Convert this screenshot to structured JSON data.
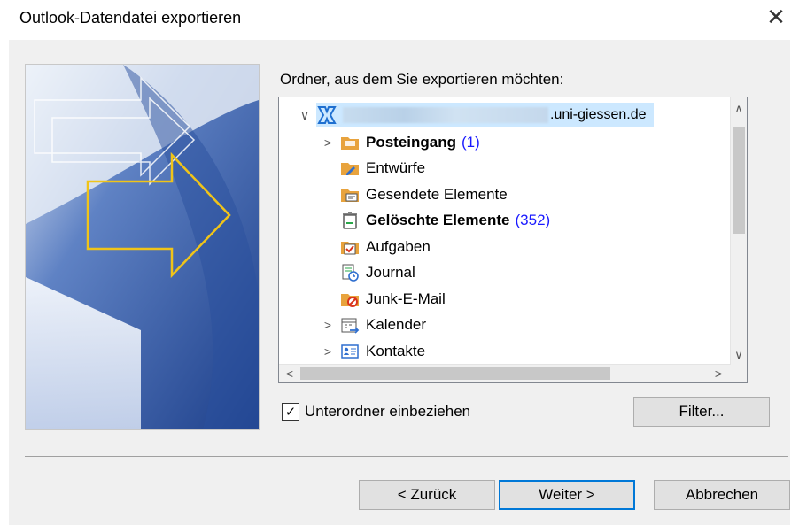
{
  "dialog": {
    "title": "Outlook-Datendatei exportieren",
    "close_glyph": "✕"
  },
  "folder_section": {
    "label": "Ordner, aus dem Sie exportieren möchten:",
    "account": {
      "expander": "∨",
      "domain_suffix": ".uni-giessen.de",
      "icon": "exchange-account-icon"
    },
    "folders": [
      {
        "name": "Posteingang",
        "count": "(1)",
        "bold": true,
        "expander": ">",
        "icon": "inbox-folder-icon"
      },
      {
        "name": "Entwürfe",
        "count": "",
        "bold": false,
        "expander": "",
        "icon": "drafts-folder-icon"
      },
      {
        "name": "Gesendete Elemente",
        "count": "",
        "bold": false,
        "expander": "",
        "icon": "sent-folder-icon"
      },
      {
        "name": "Gelöschte Elemente",
        "count": "(352)",
        "bold": true,
        "expander": "",
        "icon": "trash-folder-icon"
      },
      {
        "name": "Aufgaben",
        "count": "",
        "bold": false,
        "expander": "",
        "icon": "tasks-folder-icon"
      },
      {
        "name": "Journal",
        "count": "",
        "bold": false,
        "expander": "",
        "icon": "journal-folder-icon"
      },
      {
        "name": "Junk-E-Mail",
        "count": "",
        "bold": false,
        "expander": "",
        "icon": "junk-folder-icon"
      },
      {
        "name": "Kalender",
        "count": "",
        "bold": false,
        "expander": ">",
        "icon": "calendar-folder-icon"
      },
      {
        "name": "Kontakte",
        "count": "",
        "bold": false,
        "expander": ">",
        "icon": "contacts-folder-icon"
      }
    ],
    "scroll": {
      "up": "∧",
      "down": "∨",
      "left": "<",
      "right": ">"
    }
  },
  "options": {
    "include_subfolders_label": "Unterordner einbeziehen",
    "include_subfolders_checked": true,
    "check_glyph": "✓",
    "filter_label": "Filter..."
  },
  "buttons": {
    "back_label": "< Zurück",
    "next_label": "Weiter >",
    "cancel_label": "Abbrechen"
  },
  "colors": {
    "accent": "#0078d7",
    "selection": "#cce8ff",
    "count": "#1a1aff"
  }
}
